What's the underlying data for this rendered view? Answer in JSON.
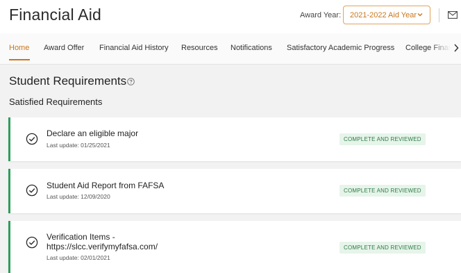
{
  "header": {
    "title": "Financial Aid",
    "award_year_label": "Award Year:",
    "award_year_value": "2021-2022 Aid Year"
  },
  "tabs": [
    {
      "label": "Home",
      "active": true
    },
    {
      "label": "Award Offer"
    },
    {
      "label": "Financial Aid History"
    },
    {
      "label": "Resources"
    },
    {
      "label": "Notifications"
    },
    {
      "label": "Satisfactory Academic Progress"
    },
    {
      "label": "College Finan"
    }
  ],
  "page": {
    "section_title": "Student Requirements",
    "subsection_title": "Satisfied Requirements"
  },
  "requirements": [
    {
      "name": "Declare an eligible major",
      "last_update": "Last update: 01/25/2021",
      "status": "COMPLETE AND REVIEWED"
    },
    {
      "name": "Student Aid Report from FAFSA",
      "last_update": "Last update: 12/09/2020",
      "status": "COMPLETE AND REVIEWED"
    },
    {
      "name_line1": "Verification Items -",
      "name_line2": "https://slcc.verifymyfafsa.com/",
      "last_update": "Last update: 02/01/2021",
      "status": "COMPLETE AND REVIEWED"
    }
  ],
  "colors": {
    "accent": "#c8761c",
    "success": "#2e9e5b",
    "badge_bg": "#e6f4ea"
  },
  "icons": [
    "chevron-down-icon",
    "mail-icon",
    "chevron-right-icon",
    "help-circle-icon",
    "check-circle-icon"
  ]
}
